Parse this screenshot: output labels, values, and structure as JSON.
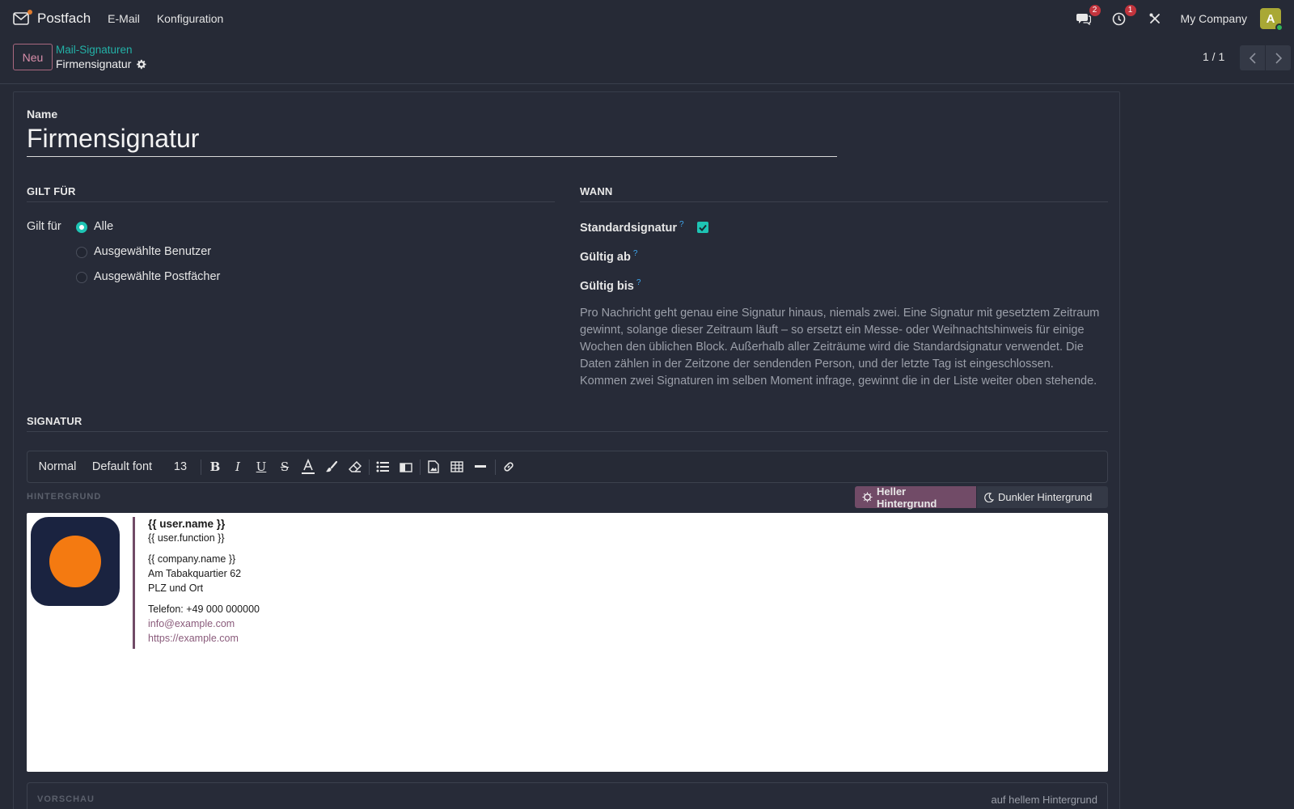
{
  "navbar": {
    "app_name": "Postfach",
    "menus": [
      "E-Mail",
      "Konfiguration"
    ],
    "messages_count": "2",
    "activities_count": "1",
    "company": "My Company",
    "avatar_initial": "A"
  },
  "control_panel": {
    "new_button": "Neu",
    "breadcrumb_parent": "Mail-Signaturen",
    "breadcrumb_current": "Firmensignatur",
    "pager": "1 / 1"
  },
  "form": {
    "name_label": "Name",
    "name_value": "Firmensignatur",
    "applies_section": "GILT FÜR",
    "applies_label": "Gilt für",
    "applies_options": [
      {
        "label": "Alle",
        "selected": true
      },
      {
        "label": "Ausgewählte Benutzer",
        "selected": false
      },
      {
        "label": "Ausgewählte Postfächer",
        "selected": false
      }
    ],
    "when_section": "WANN",
    "default_label": "Standardsignatur",
    "default_checked": true,
    "valid_from_label": "Gültig ab",
    "valid_until_label": "Gültig bis",
    "tooltip_mark": "?",
    "help_text": "Pro Nachricht geht genau eine Signatur hinaus, niemals zwei. Eine Signatur mit gesetztem Zeitraum gewinnt, solange dieser Zeitraum läuft – so ersetzt ein Messe- oder Weihnachtshinweis für einige Wochen den üblichen Block. Außerhalb aller Zeiträume wird die Standardsignatur verwendet. Die Daten zählen in der Zeitzone der sendenden Person, und der letzte Tag ist eingeschlossen. Kommen zwei Signaturen im selben Moment infrage, gewinnt die in der Liste weiter oben stehende.",
    "signature_section": "SIGNATUR"
  },
  "editor": {
    "toolbar": {
      "paragraph_style": "Normal",
      "font": "Default font",
      "font_size": "13"
    },
    "background_label": "HINTERGRUND",
    "light_bg_button": "Heller Hintergrund",
    "dark_bg_button": "Dunkler Hintergrund",
    "signature": {
      "user_name": "{{ user.name }}",
      "user_function": "{{ user.function }}",
      "company_name": "{{ company.name }}",
      "street": "Am Tabakquartier 62",
      "city": "PLZ und Ort",
      "phone": "Telefon: +49 000 000000",
      "email": "info@example.com",
      "website": "https://example.com"
    },
    "colors": {
      "accent": "#714b67",
      "logo_bg": "#1a2340",
      "logo_circle": "#f47a11",
      "link": "#8a5b7b"
    }
  },
  "preview": {
    "label": "VORSCHAU",
    "mode": "auf hellem Hintergrund"
  }
}
